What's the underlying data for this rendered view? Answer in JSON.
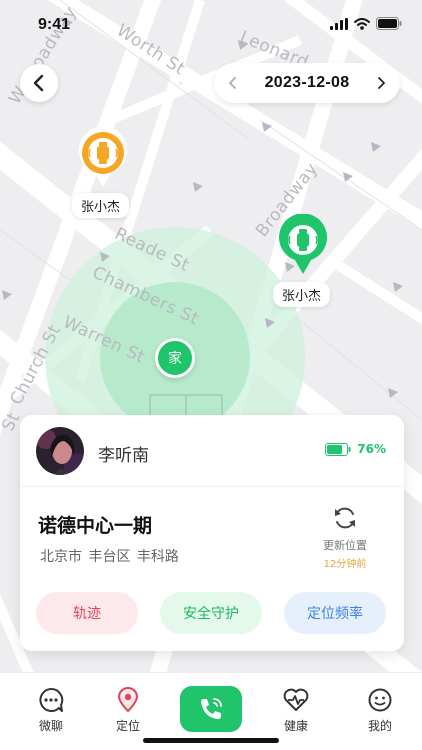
{
  "status": {
    "time": "9:41"
  },
  "header": {
    "date": "2023-12-08"
  },
  "map": {
    "streets": [
      "Worth St",
      "Leonard",
      "W Broadway",
      "Broadway",
      "Reade St",
      "Chambers St",
      "Warren St",
      "Church St",
      "St"
    ],
    "home_label": "家",
    "markers": [
      {
        "name": "张小杰",
        "color": "#f5a623"
      },
      {
        "name": "张小杰",
        "color": "#1fc46b"
      }
    ]
  },
  "card": {
    "user_name": "李听南",
    "battery": "76%",
    "place_title": "诺德中心一期",
    "place_sub": "北京市 丰台区 丰科路",
    "refresh_label": "更新位置",
    "refresh_ago": "12分钟前",
    "buttons": {
      "track": "轨迹",
      "guard": "安全守护",
      "freq": "定位频率"
    }
  },
  "tabs": {
    "chat": "微聊",
    "locate": "定位",
    "health": "健康",
    "mine": "我的"
  },
  "colors": {
    "accent": "#1fc46b",
    "orange": "#f5a623",
    "red": "#e0455c",
    "blue": "#3a86e0"
  }
}
